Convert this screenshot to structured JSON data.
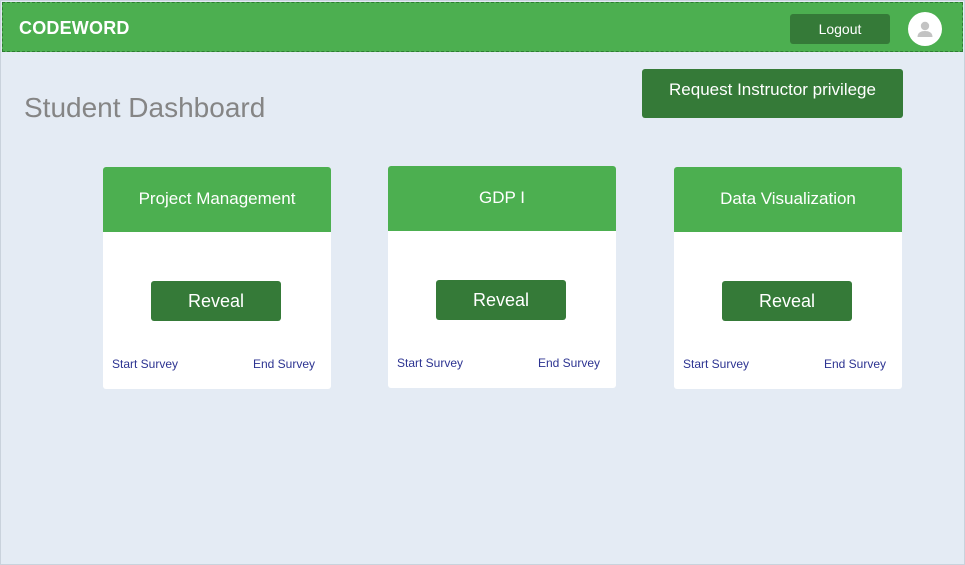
{
  "header": {
    "brand": "CODEWORD",
    "logout_label": "Logout",
    "avatar_icon": "user-avatar-icon"
  },
  "page": {
    "title": "Student Dashboard",
    "request_label": "Request Instructor privilege"
  },
  "courses": [
    {
      "title": "Project Management",
      "reveal_label": "Reveal",
      "start_label": "Start Survey",
      "end_label": "End Survey"
    },
    {
      "title": "GDP I",
      "reveal_label": "Reveal",
      "start_label": "Start Survey",
      "end_label": "End Survey"
    },
    {
      "title": "Data Visualization",
      "reveal_label": "Reveal",
      "start_label": "Start Survey",
      "end_label": "End Survey"
    }
  ],
  "colors": {
    "primary": "#4caf50",
    "primary_dark": "#357a38",
    "background": "#e4ebf4",
    "link": "#2c3391"
  }
}
